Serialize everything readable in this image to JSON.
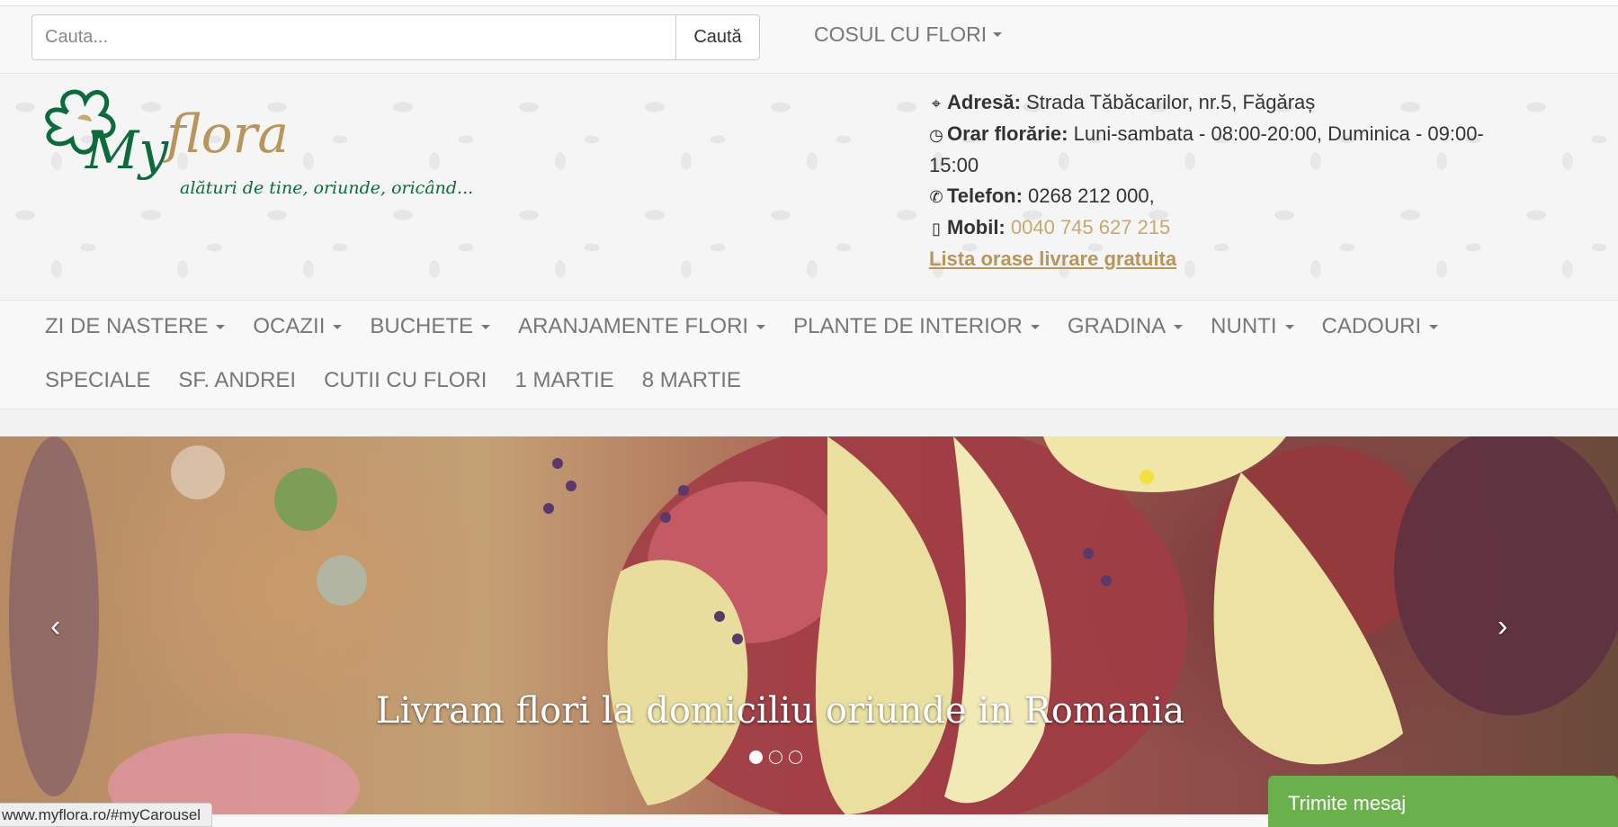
{
  "search": {
    "placeholder": "Cauta...",
    "button_label": "Caută"
  },
  "cart": {
    "label": "COSUL CU FLORI"
  },
  "logo": {
    "brand_a": "My",
    "brand_b": "flora",
    "tagline": "alături de tine, oriunde, oricând..."
  },
  "contact": {
    "address_label": "Adresă:",
    "address_value": "Strada Tăbăcarilor, nr.5, Făgăraș",
    "hours_label": "Orar florărie:",
    "hours_value": "Luni-sambata - 08:00-20:00, Duminica - 09:00-15:00",
    "phone_label": "Telefon:",
    "phone_value": "0268 212 000,",
    "mobile_label": "Mobil:",
    "mobile_value": "0040 745 627 215",
    "free_delivery_link": "Lista orase livrare gratuita"
  },
  "nav": {
    "row1": [
      {
        "label": "ZI DE NASTERE",
        "dropdown": true
      },
      {
        "label": "OCAZII",
        "dropdown": true
      },
      {
        "label": "BUCHETE",
        "dropdown": true
      },
      {
        "label": "ARANJAMENTE FLORI",
        "dropdown": true
      },
      {
        "label": "PLANTE DE INTERIOR",
        "dropdown": true
      },
      {
        "label": "GRADINA",
        "dropdown": true
      },
      {
        "label": "NUNTI",
        "dropdown": true
      },
      {
        "label": "CADOURI",
        "dropdown": true
      }
    ],
    "row2": [
      {
        "label": "SPECIALE"
      },
      {
        "label": "SF. ANDREI"
      },
      {
        "label": "CUTII CU FLORI"
      },
      {
        "label": "1 MARTIE"
      },
      {
        "label": "8 MARTIE"
      }
    ]
  },
  "carousel": {
    "caption": "Livram flori la domiciliu oriunde in Romania",
    "prev": "‹",
    "next": "›",
    "slides": 3,
    "active_slide": 1
  },
  "status_bar": {
    "url": "www.myflora.ro/#myCarousel"
  },
  "chat": {
    "label": "Trimite mesaj"
  },
  "colors": {
    "accent_gold": "#c8a96a",
    "logo_green": "#0b6b3a",
    "chat_green": "#6ab04c",
    "nav_text": "#777777"
  }
}
